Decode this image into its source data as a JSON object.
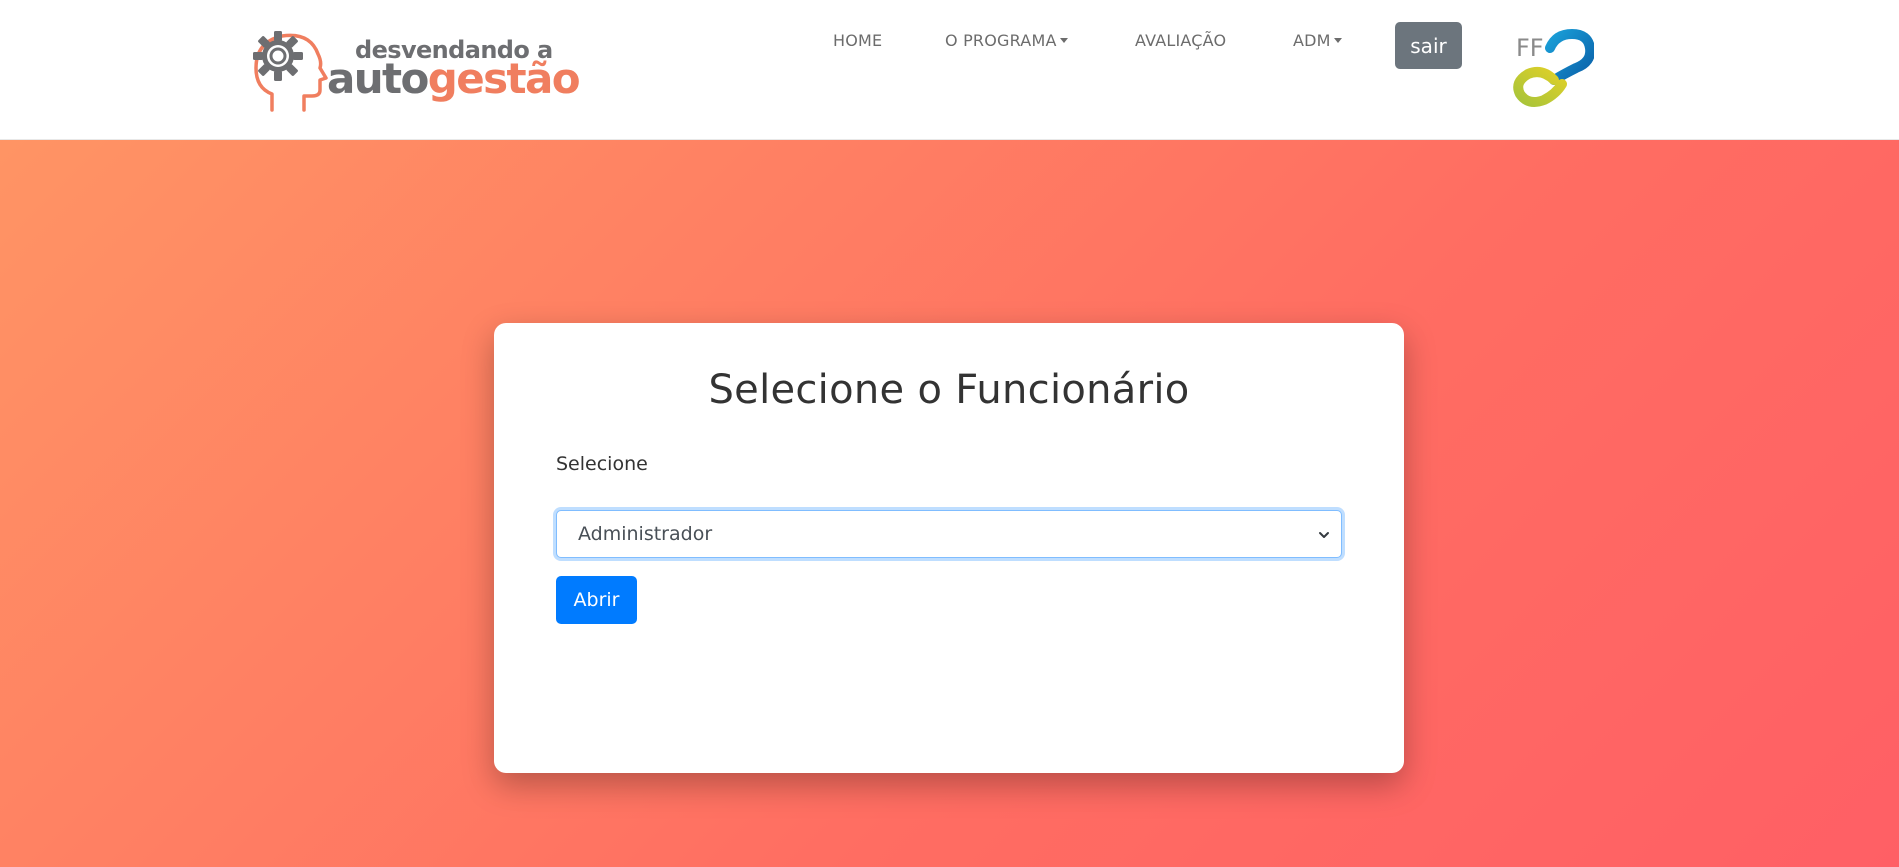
{
  "header": {
    "logo": {
      "line1": "desvendando a",
      "line2_part1": "auto",
      "line2_part2": "gestão",
      "icon": "gear-head-icon"
    },
    "nav": [
      {
        "label": "HOME",
        "dropdown": false
      },
      {
        "label": "O PROGRAMA",
        "dropdown": true
      },
      {
        "label": "AVALIAÇÃO",
        "dropdown": false
      },
      {
        "label": "ADM",
        "dropdown": true
      }
    ],
    "logout_label": "sair",
    "partner_logo": {
      "text": "FF",
      "icon": "infinity-loop-icon"
    }
  },
  "card": {
    "title": "Selecione o Funcionário",
    "select_label": "Selecione",
    "select_value": "Administrador",
    "submit_label": "Abrir"
  },
  "colors": {
    "brand_orange": "#f07e5f",
    "brand_gray": "#6d6e71",
    "gradient_start": "#ff9464",
    "gradient_end": "#ff5f65",
    "primary_button": "#007bff",
    "secondary_button": "#6c757d"
  }
}
